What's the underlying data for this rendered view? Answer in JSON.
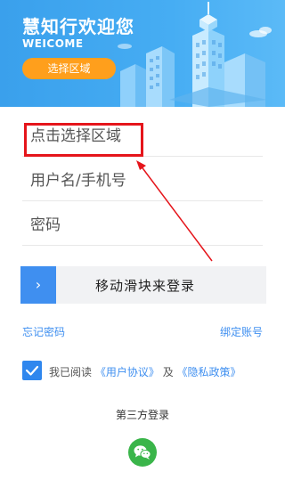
{
  "header": {
    "title": "慧知行欢迎您",
    "subtitle": "WEICOME",
    "region_button": "选择区域",
    "bg_color": "#46adf3",
    "button_color": "#ff9f1c"
  },
  "form": {
    "region_placeholder": "点击选择区域",
    "username_placeholder": "用户名/手机号",
    "password_placeholder": "密码"
  },
  "slider": {
    "handle_glyph": "›",
    "label": "移动滑块来登录",
    "accent": "#3f8ff0"
  },
  "links": {
    "forgot_password": "忘记密码",
    "bind_account": "绑定账号"
  },
  "agreement": {
    "prefix": "我已阅读",
    "user_agreement": "《用户协议》",
    "and": "及",
    "privacy_policy": "《隐私政策》",
    "checked": true
  },
  "third_party": {
    "title": "第三方登录",
    "icon": "wechat-icon",
    "color": "#3ab54a"
  },
  "annotation": {
    "color": "#e5151b"
  }
}
